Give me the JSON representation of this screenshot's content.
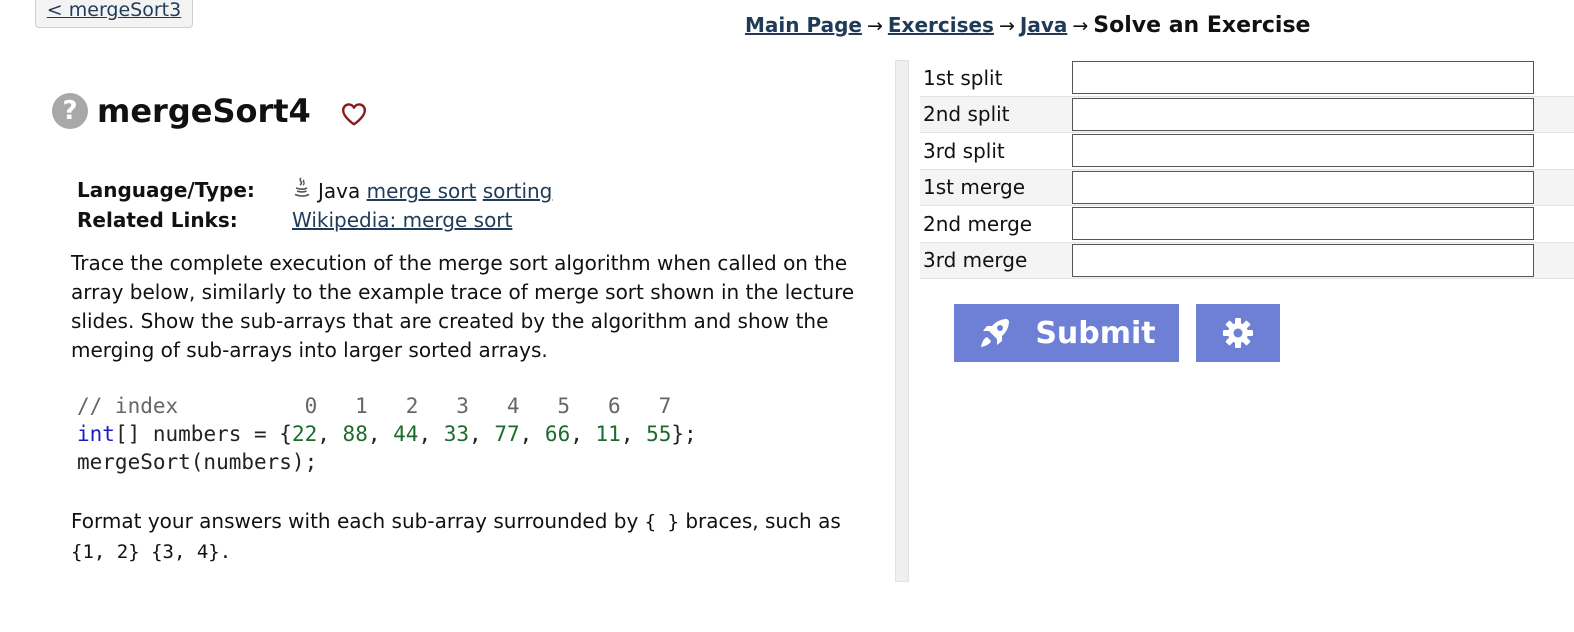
{
  "nav": {
    "prev_link": "< mergeSort3"
  },
  "breadcrumb": {
    "items": [
      "Main Page",
      "Exercises",
      "Java"
    ],
    "arrow": "→",
    "current": "Solve an Exercise"
  },
  "problem": {
    "help_glyph": "?",
    "title": "mergeSort4",
    "language_label": "Language/Type:",
    "language": "Java",
    "tags": [
      "merge sort",
      "sorting"
    ],
    "related_label": "Related Links:",
    "related_links": [
      "Wikipedia: merge sort"
    ],
    "description": "Trace the complete execution of the merge sort algorithm when called on the array below, similarly to the example trace of merge sort shown in the lecture slides. Show the sub-arrays that are created by the algorithm and show the merging of sub-arrays into larger sorted arrays.",
    "code": {
      "comment": "// index          0   1   2   3   4   5   6   7",
      "type_kw": "int",
      "decl_rest": "[] numbers = {",
      "values": [
        "22",
        "88",
        "44",
        "33",
        "77",
        "66",
        "11",
        "55"
      ],
      "decl_end": "};",
      "call": "mergeSort(numbers);"
    },
    "format_note_prefix": "Format your answers with each sub-array surrounded by",
    "format_note_braces": "{ }",
    "format_note_middle": "braces, such as",
    "format_note_example": "{1, 2} {3, 4}."
  },
  "answers": {
    "rows": [
      {
        "label": "1st split",
        "value": ""
      },
      {
        "label": "2nd split",
        "value": ""
      },
      {
        "label": "3rd split",
        "value": ""
      },
      {
        "label": "1st merge",
        "value": ""
      },
      {
        "label": "2nd merge",
        "value": ""
      },
      {
        "label": "3rd merge",
        "value": ""
      }
    ]
  },
  "actions": {
    "submit_label": "Submit",
    "submit_icon": "rocket-icon",
    "settings_icon": "gear-icon"
  },
  "colors": {
    "button_bg": "#6d80d6",
    "link": "#1f3b57",
    "heart": "#8b1a1a",
    "code_keyword": "#1c1cbf",
    "code_number": "#1b6b2d"
  }
}
